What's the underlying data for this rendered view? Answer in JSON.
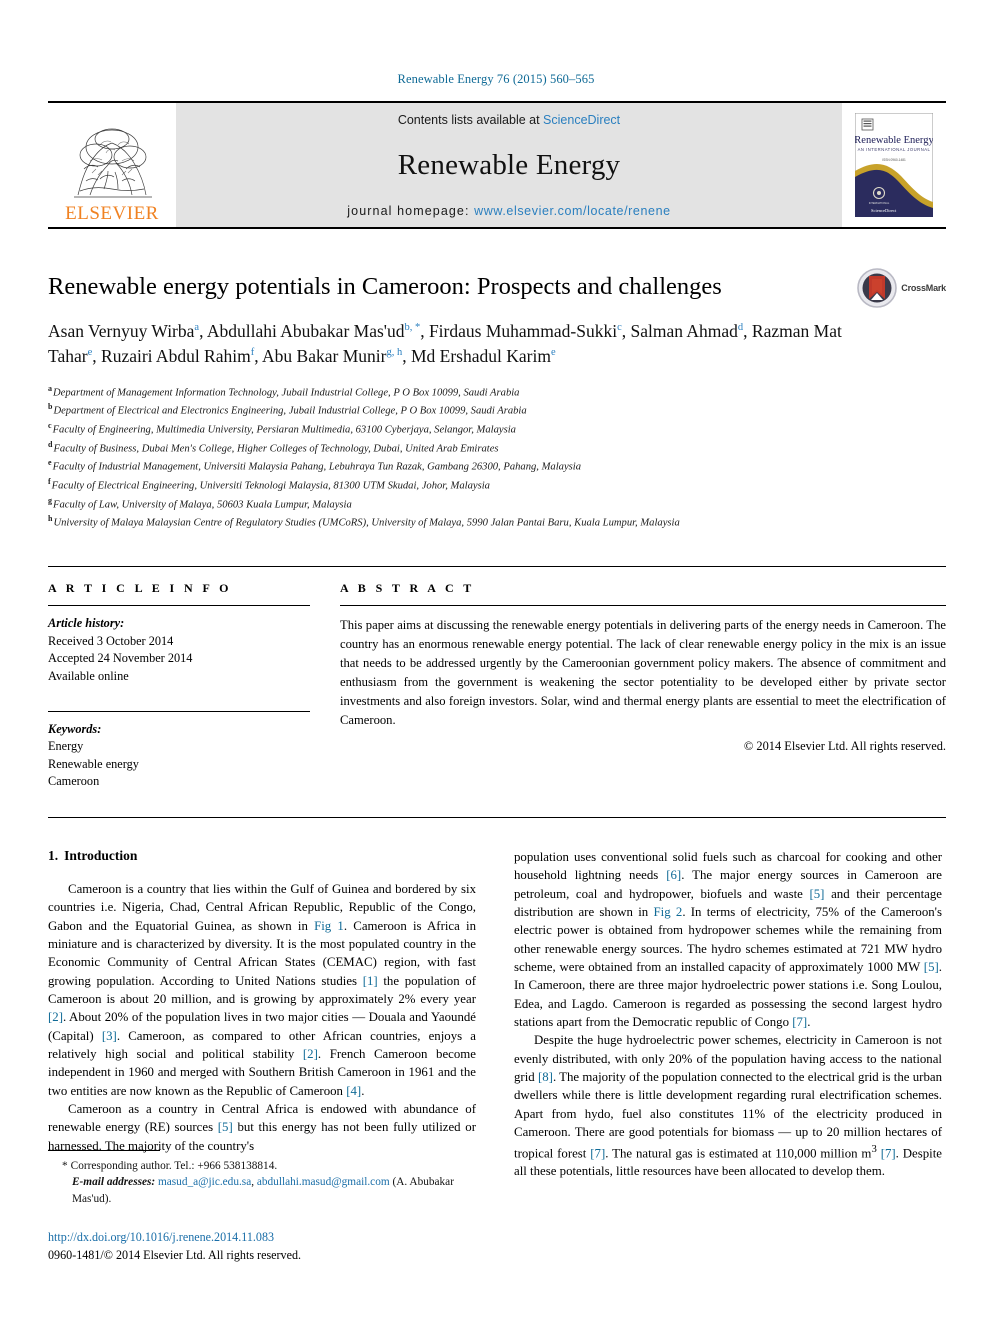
{
  "running_head": "Renewable Energy 76 (2015) 560–565",
  "masthead": {
    "publisher_name": "ELSEVIER",
    "contents_prefix": "Contents lists available at ",
    "contents_link": "ScienceDirect",
    "journal_name": "Renewable Energy",
    "homepage_prefix": "journal homepage: ",
    "homepage_url": "www.elsevier.com/locate/renene",
    "cover": {
      "title": "Renewable Energy",
      "subtitle": "AN INTERNATIONAL JOURNAL",
      "tagline": "ISSN 0960-1481",
      "footer": "ScienceDirect"
    }
  },
  "article": {
    "title": "Renewable energy potentials in Cameroon: Prospects and challenges",
    "crossmark_label": "CrossMark",
    "authors": [
      {
        "name": "Asan Vernyuy Wirba",
        "marks": "a",
        "sep": ", "
      },
      {
        "name": "Abdullahi Abubakar Mas'ud",
        "marks": "b, *",
        "sep": ", "
      },
      {
        "name": "Firdaus Muhammad-Sukki",
        "marks": "c",
        "sep": ", "
      },
      {
        "name": "Salman Ahmad",
        "marks": "d",
        "sep": ", "
      },
      {
        "name": "Razman Mat Tahar",
        "marks": "e",
        "sep": ", "
      },
      {
        "name": "Ruzairi Abdul Rahim",
        "marks": "f",
        "sep": ", "
      },
      {
        "name": "Abu Bakar Munir",
        "marks": "g, h",
        "sep": ", "
      },
      {
        "name": "Md Ershadul Karim",
        "marks": "e",
        "sep": ""
      }
    ],
    "affiliations": [
      {
        "mark": "a",
        "text": "Department of Management Information Technology, Jubail Industrial College, P O Box 10099, Saudi Arabia"
      },
      {
        "mark": "b",
        "text": "Department of Electrical and Electronics Engineering, Jubail Industrial College, P O Box 10099, Saudi Arabia"
      },
      {
        "mark": "c",
        "text": "Faculty of Engineering, Multimedia University, Persiaran Multimedia, 63100 Cyberjaya, Selangor, Malaysia"
      },
      {
        "mark": "d",
        "text": "Faculty of Business, Dubai Men's College, Higher Colleges of Technology, Dubai, United Arab Emirates"
      },
      {
        "mark": "e",
        "text": "Faculty of Industrial Management, Universiti Malaysia Pahang, Lebuhraya Tun Razak, Gambang 26300, Pahang, Malaysia"
      },
      {
        "mark": "f",
        "text": "Faculty of Electrical Engineering, Universiti Teknologi Malaysia, 81300 UTM Skudai, Johor, Malaysia"
      },
      {
        "mark": "g",
        "text": "Faculty of Law, University of Malaya, 50603 Kuala Lumpur, Malaysia"
      },
      {
        "mark": "h",
        "text": "University of Malaya Malaysian Centre of Regulatory Studies (UMCoRS), University of Malaya, 5990 Jalan Pantai Baru, Kuala Lumpur, Malaysia"
      }
    ]
  },
  "article_info": {
    "heading": "A R T I C L E  I N F O",
    "history_label": "Article history:",
    "history": [
      "Received 3 October 2014",
      "Accepted 24 November 2014",
      "Available online"
    ],
    "keywords_label": "Keywords:",
    "keywords": [
      "Energy",
      "Renewable energy",
      "Cameroon"
    ]
  },
  "abstract": {
    "heading": "A B S T R A C T",
    "text": "This paper aims at discussing the renewable energy potentials in delivering parts of the energy needs in Cameroon. The country has an enormous renewable energy potential. The lack of clear renewable energy policy in the mix is an issue that needs to be addressed urgently by the Cameroonian government policy makers. The absence of commitment and enthusiasm from the government is weakening the sector potentiality to be developed either by private sector investments and also foreign investors. Solar, wind and thermal energy plants are essential to meet the electrification of Cameroon.",
    "copyright": "© 2014 Elsevier Ltd. All rights reserved."
  },
  "body": {
    "section_number": "1.",
    "section_title": "Introduction",
    "left_column": {
      "para1_a": "Cameroon is a country that lies within the Gulf of Guinea and bordered by six countries i.e. Nigeria, Chad, Central African Republic, Republic of the Congo, Gabon and the Equatorial Guinea, as shown in ",
      "figref1": "Fig 1",
      "para1_b": ". Cameroon is Africa in miniature and is characterized by diversity. It is the most populated country in the Economic Community of Central African States (CEMAC) region, with fast growing population. According to United Nations studies ",
      "ref1": "[1]",
      "para1_c": " the population of Cameroon is about 20 million, and is growing by approximately 2% every year ",
      "ref2": "[2]",
      "para1_d": ". About 20% of the population lives in two major cities — Douala and Yaoundé (Capital) ",
      "ref3": "[3]",
      "para1_e": ". Cameroon, as compared to other African countries, enjoys a relatively high social and political stability ",
      "ref4": "[2]",
      "para1_f": ". French Cameroon become independent in 1960 and merged with Southern British Cameroon in 1961 and the two entities are now known as the Republic of Cameroon ",
      "ref5": "[4]",
      "para1_g": ".",
      "para2_a": "Cameroon as a country in Central Africa is endowed with abundance of renewable energy (RE) sources ",
      "ref6": "[5]",
      "para2_b": " but this energy has not been fully utilized or harnessed. The majority of the country's"
    },
    "right_column": {
      "para_a": "population uses conventional solid fuels such as charcoal for cooking and other household lightning needs ",
      "ref6b": "[6]",
      "para_b": ". The major energy sources in Cameroon are petroleum, coal and hydropower, biofuels and waste ",
      "ref5b": "[5]",
      "para_c": " and their percentage distribution are shown in ",
      "figref2": "Fig 2",
      "para_d": ". In terms of electricity, 75% of the Cameroon's electric power is obtained from hydropower schemes while the remaining from other renewable energy sources. The hydro schemes estimated at 721 MW hydro scheme, were obtained from an installed capacity of approximately 1000 MW ",
      "ref5c": "[5]",
      "para_e": ". In Cameroon, there are three major hydroelectric power stations i.e. Song Loulou, Edea, and Lagdo. Cameroon is regarded as possessing the second largest hydro stations apart from the Democratic republic of Congo ",
      "ref7": "[7]",
      "para_f": ".",
      "para2_a": "Despite the huge hydroelectric power schemes, electricity in Cameroon is not evenly distributed, with only 20% of the population having access to the national grid ",
      "ref8": "[8]",
      "para2_b": ". The majority of the population connected to the electrical grid is the urban dwellers while there is little development regarding rural electrification schemes. Apart from hydo, fuel also constitutes 11% of the electricity produced in Cameroon. There are good potentials for biomass — up to 20 million hectares of tropical forest ",
      "ref7b": "[7]",
      "para2_c": ". The natural gas is estimated at 110,000 million m",
      "sup3": "3",
      "para2_d": " ",
      "ref7c": "[7]",
      "para2_e": ". Despite all these potentials, little resources have been allocated to develop them."
    }
  },
  "footnotes": {
    "corresponding": "Corresponding author. Tel.: +966 538138814.",
    "email_label": "E-mail addresses:",
    "email1": "masud_a@jic.edu.sa",
    "email_sep": ", ",
    "email2": "abdullahi.masud@gmail.com",
    "email_suffix": " (A. Abubakar Mas'ud)."
  },
  "doi": {
    "url": "http://dx.doi.org/10.1016/j.renene.2014.11.083",
    "issn_line": "0960-1481/© 2014 Elsevier Ltd. All rights reserved."
  },
  "colors": {
    "link_blue": "#2a7fbf",
    "ref_blue": "#0f6a96",
    "elsevier_orange": "#f08222",
    "band_gray": "#e3e3e3",
    "crossmark_red": "#c0392b",
    "cover_navy": "#2b2c5e",
    "cover_gold": "#c8a22a"
  }
}
